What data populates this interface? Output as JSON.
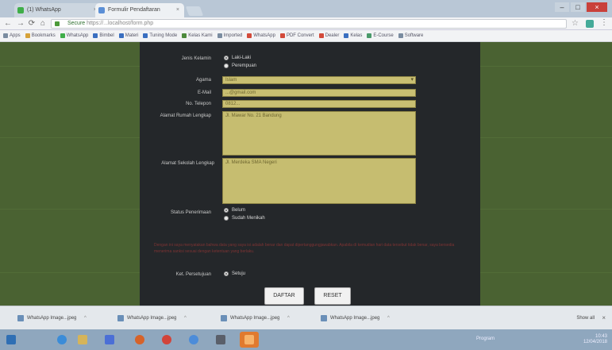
{
  "browser": {
    "tabs": [
      {
        "label": "(1) WhatsApp",
        "active": false
      },
      {
        "label": "Formulir Pendaftaran",
        "active": true
      }
    ],
    "address": {
      "secure_label": "Secure",
      "url": "https://...localhost/form.php"
    },
    "bookmarks": [
      {
        "label": "Apps",
        "color": "#7a8ca0"
      },
      {
        "label": "Bookmarks",
        "color": "#d6a23a"
      },
      {
        "label": "WhatsApp",
        "color": "#3fae49"
      },
      {
        "label": "Bimbel",
        "color": "#3a6fc0"
      },
      {
        "label": "Materi",
        "color": "#3a6fc0"
      },
      {
        "label": "Tuning Mode",
        "color": "#3a6fc0"
      },
      {
        "label": "Kelas Kami",
        "color": "#4d8a3c"
      },
      {
        "label": "Imported",
        "color": "#7a8ca0"
      },
      {
        "label": "WhatsApp",
        "color": "#d24a3a"
      },
      {
        "label": "PDF Convert",
        "color": "#d24a3a"
      },
      {
        "label": "Dealer",
        "color": "#d24a3a"
      },
      {
        "label": "Kelas",
        "color": "#3a6fc0"
      },
      {
        "label": "E-Course",
        "color": "#4a9a6a"
      },
      {
        "label": "Software",
        "color": "#7a8ca0"
      }
    ]
  },
  "form": {
    "gender": {
      "label": "Jenis Kelamin",
      "options": [
        {
          "label": "Laki-Laki",
          "selected": true
        },
        {
          "label": "Perempuan",
          "selected": false
        }
      ]
    },
    "agama": {
      "label": "Agama",
      "value": "Islam"
    },
    "email": {
      "label": "E-Mail",
      "value": "...@gmail.com"
    },
    "phone": {
      "label": "No. Telepon",
      "value": "0812..."
    },
    "alamat_rumah": {
      "label": "Alamat Rumah Lengkap",
      "value": "Jl. Mawar No. 21 Bandung"
    },
    "alamat_sekolah": {
      "label": "Alamat Sekolah Lengkap",
      "value": "Jl. Merdeka SMA Negeri"
    },
    "status": {
      "label": "Status Penerimaan",
      "options": [
        {
          "label": "Belum",
          "selected": true
        },
        {
          "label": "Sudah Menikah",
          "selected": false
        }
      ]
    },
    "note": "Dengan ini saya menyatakan bahwa data yang saya isi adalah benar dan dapat dipertanggungjawabkan. Apabila di kemudian hari data tersebut tidak benar, saya bersedia menerima sanksi sesuai dengan ketentuan yang berlaku.",
    "agree": {
      "label": "Ket. Persetujuan",
      "option_label": "Setuju",
      "selected": true
    },
    "submit_label": "DAFTAR",
    "reset_label": "RESET"
  },
  "downloads": {
    "items": [
      {
        "label": "WhatsApp Image...jpeg"
      },
      {
        "label": "WhatsApp Image...jpeg"
      },
      {
        "label": "WhatsApp Image...jpeg"
      },
      {
        "label": "WhatsApp Image...jpeg"
      }
    ],
    "show_all_label": "Show all"
  },
  "taskbar": {
    "tray_label": "Program",
    "clock_time": "10:43",
    "clock_date": "12/04/2018"
  },
  "colors": {
    "page_bg": "#4a6232",
    "panel_bg": "#24272a",
    "field_bg": "#c9bf72"
  }
}
